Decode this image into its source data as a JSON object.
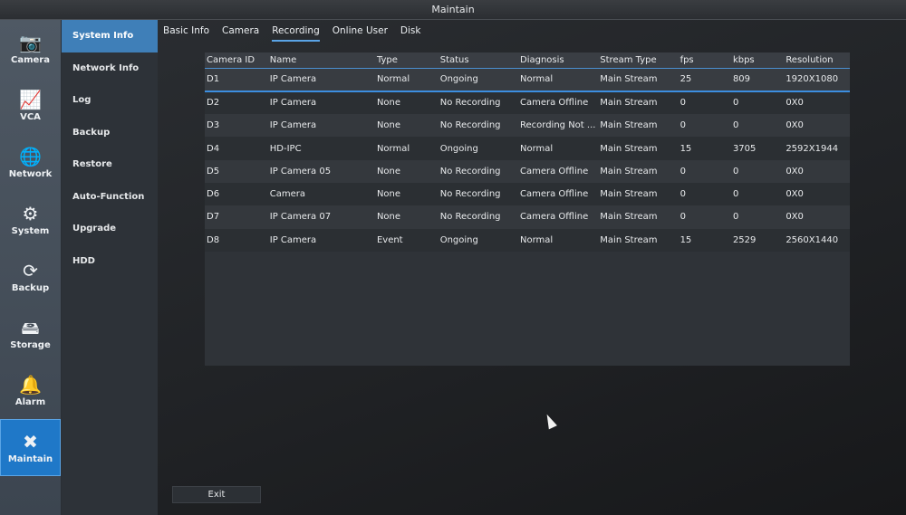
{
  "window": {
    "title": "Maintain"
  },
  "left_nav": [
    {
      "label": "Camera",
      "icon": "camera-icon",
      "glyph": "📷",
      "active": false
    },
    {
      "label": "VCA",
      "icon": "vca-icon",
      "glyph": "📈",
      "active": false
    },
    {
      "label": "Network",
      "icon": "network-icon",
      "glyph": "🌐",
      "active": false
    },
    {
      "label": "System",
      "icon": "system-gear-icon",
      "glyph": "⚙",
      "active": false
    },
    {
      "label": "Backup",
      "icon": "backup-icon",
      "glyph": "⟳",
      "active": false
    },
    {
      "label": "Storage",
      "icon": "storage-icon",
      "glyph": "🖴",
      "active": false
    },
    {
      "label": "Alarm",
      "icon": "alarm-icon",
      "glyph": "🔔",
      "active": false
    },
    {
      "label": "Maintain",
      "icon": "tools-icon",
      "glyph": "✖",
      "active": true
    }
  ],
  "sub_nav": [
    {
      "label": "System Info",
      "active": true
    },
    {
      "label": "Network Info",
      "active": false
    },
    {
      "label": "Log",
      "active": false
    },
    {
      "label": "Backup",
      "active": false
    },
    {
      "label": "Restore",
      "active": false
    },
    {
      "label": "Auto-Function",
      "active": false
    },
    {
      "label": "Upgrade",
      "active": false
    },
    {
      "label": "HDD",
      "active": false
    }
  ],
  "tabs": [
    {
      "label": "Basic Info",
      "active": false
    },
    {
      "label": "Camera",
      "active": false
    },
    {
      "label": "Recording",
      "active": true
    },
    {
      "label": "Online User",
      "active": false
    },
    {
      "label": "Disk",
      "active": false
    }
  ],
  "table": {
    "columns": [
      "Camera ID",
      "Name",
      "Type",
      "Status",
      "Diagnosis",
      "Stream Type",
      "fps",
      "kbps",
      "Resolution"
    ],
    "rows": [
      [
        "D1",
        "IP Camera",
        "Normal",
        "Ongoing",
        "Normal",
        "Main Stream",
        "25",
        "809",
        "1920X1080"
      ],
      [
        "D2",
        "IP Camera",
        "None",
        "No Recording",
        "Camera Offline",
        "Main Stream",
        "0",
        "0",
        "0X0"
      ],
      [
        "D3",
        "IP Camera",
        "None",
        "No Recording",
        "Recording Not ...",
        "Main Stream",
        "0",
        "0",
        "0X0"
      ],
      [
        "D4",
        "HD-IPC",
        "Normal",
        "Ongoing",
        "Normal",
        "Main Stream",
        "15",
        "3705",
        "2592X1944"
      ],
      [
        "D5",
        "IP Camera 05",
        "None",
        "No Recording",
        "Camera Offline",
        "Main Stream",
        "0",
        "0",
        "0X0"
      ],
      [
        "D6",
        "Camera",
        "None",
        "No Recording",
        "Camera Offline",
        "Main Stream",
        "0",
        "0",
        "0X0"
      ],
      [
        "D7",
        "IP Camera 07",
        "None",
        "No Recording",
        "Camera Offline",
        "Main Stream",
        "0",
        "0",
        "0X0"
      ],
      [
        "D8",
        "IP Camera",
        "Event",
        "Ongoing",
        "Normal",
        "Main Stream",
        "15",
        "2529",
        "2560X1440"
      ]
    ],
    "selected_row": 0
  },
  "footer": {
    "exit_label": "Exit"
  }
}
